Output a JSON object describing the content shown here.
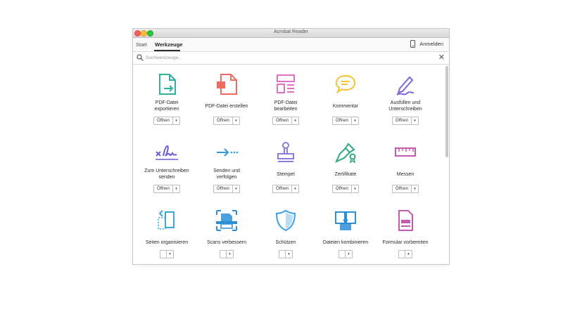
{
  "window": {
    "title": "Acrobat Reader"
  },
  "tabs": {
    "start": "Start",
    "tools": "Werkzeuge"
  },
  "signin": {
    "label": "Anmelden"
  },
  "search": {
    "placeholder": "Suchwerkzeuge..."
  },
  "tools": [
    {
      "label": "PDF-Datei\nexportieren",
      "button": "Öffnen",
      "icon": "export-pdf-icon",
      "color": "#2bb3a0"
    },
    {
      "label": "PDF-Datei erstellen",
      "button": "Öffnen",
      "icon": "create-pdf-icon",
      "color": "#ee6b5e"
    },
    {
      "label": "PDF-Datei\nbearbeiten",
      "button": "Öffnen",
      "icon": "edit-pdf-icon",
      "color": "#e36fc4"
    },
    {
      "label": "Kommentar",
      "button": "Öffnen",
      "icon": "comment-icon",
      "color": "#f4c233"
    },
    {
      "label": "Ausfüllen und\nUnterschreiben",
      "button": "Öffnen",
      "icon": "fill-sign-icon",
      "color": "#7e67d6"
    },
    {
      "label": "Zum Unterschreiben\nsenden",
      "button": "Öffnen",
      "icon": "send-for-signature-icon",
      "color": "#6a5cd6"
    },
    {
      "label": "Senden und\nverfolgen",
      "button": "Öffnen",
      "icon": "send-track-icon",
      "color": "#2f9bd8"
    },
    {
      "label": "Stempel",
      "button": "Öffnen",
      "icon": "stamp-icon",
      "color": "#8f7be0"
    },
    {
      "label": "Zertifikate",
      "button": "Öffnen",
      "icon": "certificate-icon",
      "color": "#2fa87c"
    },
    {
      "label": "Messen",
      "button": "Öffnen",
      "icon": "measure-icon",
      "color": "#c45bb0"
    },
    {
      "label": "Seiten organisieren",
      "button": "",
      "icon": "organize-pages-icon",
      "color": "#39a7e0"
    },
    {
      "label": "Scans verbessern",
      "button": "",
      "icon": "enhance-scans-icon",
      "color": "#2a8fd6"
    },
    {
      "label": "Schützen",
      "button": "",
      "icon": "protect-icon",
      "color": "#3b9fe0"
    },
    {
      "label": "Dateien kombinieren",
      "button": "",
      "icon": "combine-files-icon",
      "color": "#2a8fd6"
    },
    {
      "label": "Formular vorbereiten",
      "button": "",
      "icon": "prepare-form-icon",
      "color": "#c45bb0"
    }
  ]
}
